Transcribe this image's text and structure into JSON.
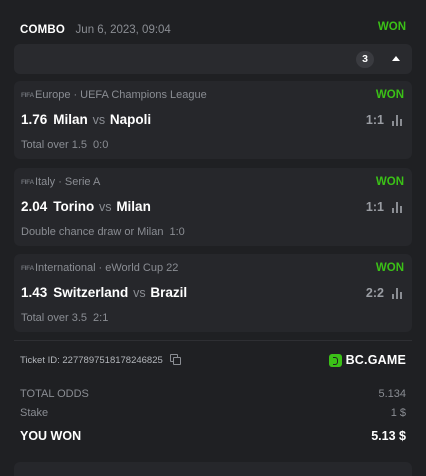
{
  "header": {
    "type": "COMBO",
    "datetime": "Jun 6, 2023, 09:04",
    "result": "WON"
  },
  "selections_count": "3",
  "bets": [
    {
      "sport_icon": "FIFA",
      "region": "Europe",
      "league": "UEFA Champions League",
      "result": "WON",
      "odds": "1.76",
      "home": "Milan",
      "vs": "vs",
      "away": "Napoli",
      "score": "1:1",
      "market": "Total over 1.5",
      "market_result": "0:0"
    },
    {
      "sport_icon": "FIFA",
      "region": "Italy",
      "league": "Serie A",
      "result": "WON",
      "odds": "2.04",
      "home": "Torino",
      "vs": "vs",
      "away": "Milan",
      "score": "1:1",
      "market": "Double chance draw or Milan",
      "market_result": "1:0"
    },
    {
      "sport_icon": "FIFA",
      "region": "International",
      "league": "eWorld Cup 22",
      "result": "WON",
      "odds": "1.43",
      "home": "Switzerland",
      "vs": "vs",
      "away": "Brazil",
      "score": "2:2",
      "market": "Total over 3.5",
      "market_result": "2:1"
    }
  ],
  "ticket": {
    "label": "Ticket ID: 2277897518178246825"
  },
  "brand": {
    "name": "BC.GAME",
    "color": "#3bc117"
  },
  "summary": {
    "total_odds_label": "TOTAL ODDS",
    "total_odds": "5.134",
    "stake_label": "Stake",
    "stake": "1 $",
    "won_label": "YOU WON",
    "won": "5.13 $"
  },
  "colors": {
    "accent_green": "#3bc117",
    "card_bg": "#1f2023",
    "bet_bg": "#26272b",
    "muted_text": "#8a8d93"
  }
}
